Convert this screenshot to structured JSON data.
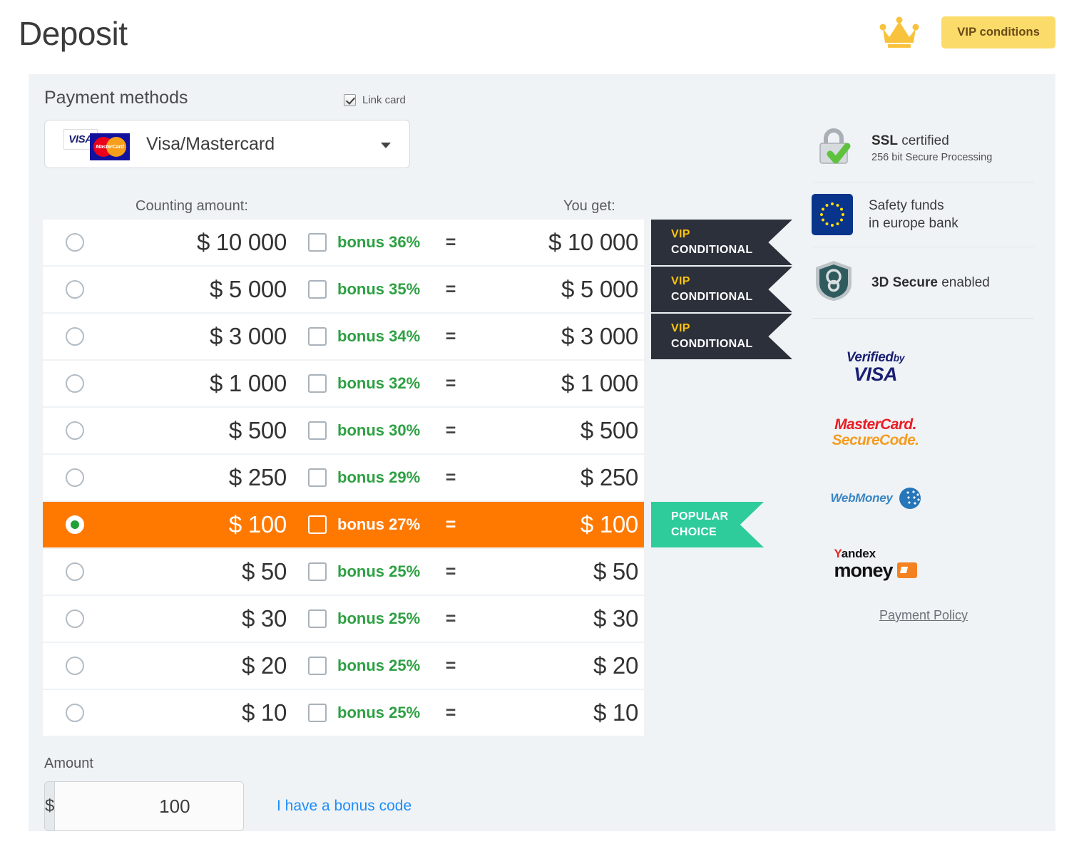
{
  "header": {
    "title": "Deposit",
    "crown_icon": "crown-icon",
    "vip_button": "VIP conditions",
    "vip_button_bg": "#FBDC6B"
  },
  "panel": {
    "title": "Payment methods",
    "link_card": {
      "label": "Link card",
      "checked": true
    },
    "method": {
      "label": "Visa/Mastercard",
      "visa_mark": "VISA",
      "mastercard_mark": "MasterCard",
      "caret": "chevron-down-icon"
    },
    "columns": {
      "left": "Counting amount:",
      "right": "You get:"
    },
    "colors": {
      "panel_bg": "#EFF3F6",
      "row_bg": "#FFFFFF",
      "selected_row": "#FF7900",
      "bonus_green": "#2EA043",
      "vip_ribbon": "#2B303B",
      "vip_accent": "#FFC20E",
      "popular_ribbon": "#2ECC9B",
      "link_blue": "#1F8EFA"
    }
  },
  "rows": [
    {
      "pay": "$ 10 000",
      "bonus": "bonus 36%",
      "eq": "=",
      "get": "$ 10 000",
      "selected": false,
      "bonus_checked": false,
      "badge": {
        "type": "vip",
        "line1": "VIP",
        "line2": "CONDITIONAL"
      }
    },
    {
      "pay": "$ 5 000",
      "bonus": "bonus 35%",
      "eq": "=",
      "get": "$ 5 000",
      "selected": false,
      "bonus_checked": false,
      "badge": {
        "type": "vip",
        "line1": "VIP",
        "line2": "CONDITIONAL"
      }
    },
    {
      "pay": "$ 3 000",
      "bonus": "bonus 34%",
      "eq": "=",
      "get": "$ 3 000",
      "selected": false,
      "bonus_checked": false,
      "badge": {
        "type": "vip",
        "line1": "VIP",
        "line2": "CONDITIONAL"
      }
    },
    {
      "pay": "$ 1 000",
      "bonus": "bonus 32%",
      "eq": "=",
      "get": "$ 1 000",
      "selected": false,
      "bonus_checked": false,
      "badge": null
    },
    {
      "pay": "$ 500",
      "bonus": "bonus 30%",
      "eq": "=",
      "get": "$ 500",
      "selected": false,
      "bonus_checked": false,
      "badge": null
    },
    {
      "pay": "$ 250",
      "bonus": "bonus 29%",
      "eq": "=",
      "get": "$ 250",
      "selected": false,
      "bonus_checked": false,
      "badge": null
    },
    {
      "pay": "$ 100",
      "bonus": "bonus 27%",
      "eq": "=",
      "get": "$ 100",
      "selected": true,
      "bonus_checked": false,
      "badge": {
        "type": "popular",
        "line1": "POPULAR",
        "line2": "CHOICE"
      }
    },
    {
      "pay": "$ 50",
      "bonus": "bonus 25%",
      "eq": "=",
      "get": "$ 50",
      "selected": false,
      "bonus_checked": false,
      "badge": null
    },
    {
      "pay": "$ 30",
      "bonus": "bonus 25%",
      "eq": "=",
      "get": "$ 30",
      "selected": false,
      "bonus_checked": false,
      "badge": null
    },
    {
      "pay": "$ 20",
      "bonus": "bonus 25%",
      "eq": "=",
      "get": "$ 20",
      "selected": false,
      "bonus_checked": false,
      "badge": null
    },
    {
      "pay": "$ 10",
      "bonus": "bonus 25%",
      "eq": "=",
      "get": "$ 10",
      "selected": false,
      "bonus_checked": false,
      "badge": null
    }
  ],
  "amount": {
    "label": "Amount",
    "currency": "$",
    "value": "100",
    "placeholder": "100",
    "bonus_code_link": "I have a bonus code"
  },
  "sidebar": {
    "trust": [
      {
        "icon": "lock-icon",
        "title_bold": "SSL",
        "title_rest": " certified",
        "sub": "256 bit Secure Processing"
      },
      {
        "icon": "eu-flag-icon",
        "title_bold": "",
        "title_rest": "Safety funds\nin europe bank",
        "sub": ""
      },
      {
        "icon": "shield-icon",
        "title_bold": "3D Secure",
        "title_rest": " enabled",
        "sub": ""
      }
    ],
    "logos": [
      {
        "name": "verified-by-visa-logo",
        "l1": "Verified",
        "l1_small": "by",
        "l2": "VISA"
      },
      {
        "name": "mastercard-securecode-logo",
        "l1": "MasterCard.",
        "l2": "SecureCode."
      },
      {
        "name": "webmoney-logo",
        "l1": "WebMoney"
      },
      {
        "name": "yandex-money-logo",
        "l1_red": "Y",
        "l1": "andex",
        "l2": "money"
      }
    ],
    "policy_link": "Payment Policy"
  }
}
